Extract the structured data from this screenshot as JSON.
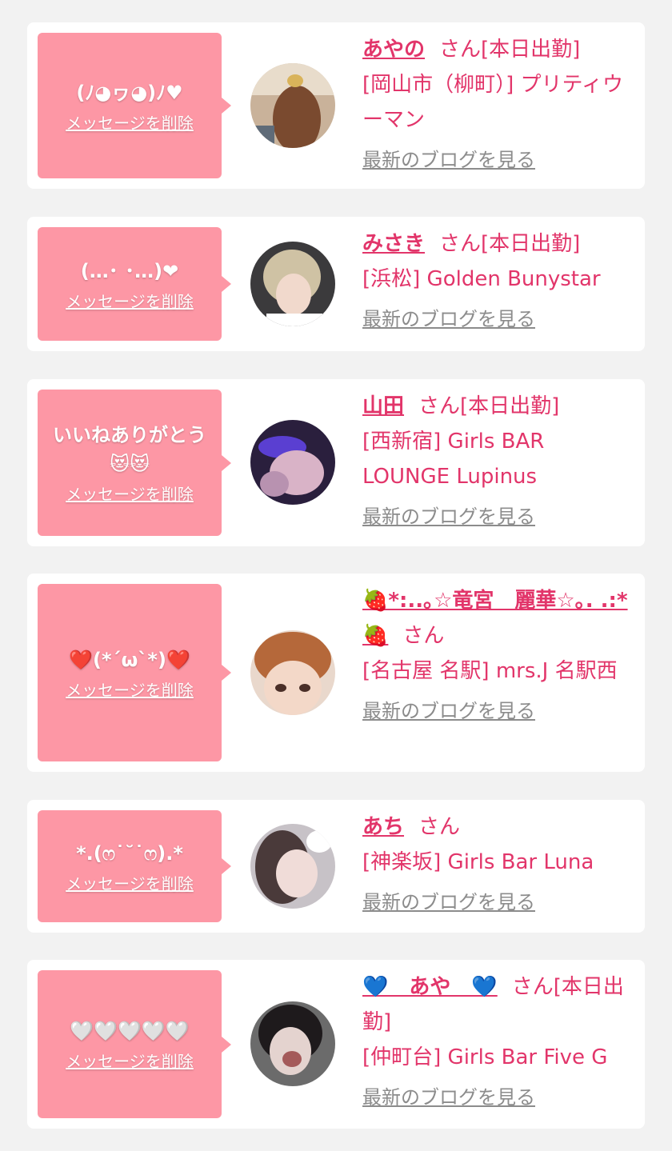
{
  "colors": {
    "background": "#f2f2f2",
    "card": "#ffffff",
    "bubble": "#fd97a5",
    "accent": "#e2356a",
    "link_gray": "#8c8c8c"
  },
  "cards": [
    {
      "message": "(ﾉ◕ヮ◕)ﾉ♥",
      "delete_label": "メッセージを削除",
      "name": "あやの",
      "status": "さん[本日出勤]",
      "shop": "[岡山市（柳町）] プリティウーマン",
      "blog_label": "最新のブログを見る",
      "avatar_icon": "avatar-photo"
    },
    {
      "message": "(…･ ･…)❤",
      "delete_label": "メッセージを削除",
      "name": "みさき",
      "status": "さん[本日出勤]",
      "shop": "[浜松] Golden Bunystar",
      "blog_label": "最新のブログを見る",
      "avatar_icon": "avatar-photo"
    },
    {
      "message": "いいねありがとう😻😻",
      "delete_label": "メッセージを削除",
      "name": "山田",
      "status": "さん[本日出勤]",
      "shop": "[西新宿] Girls BAR LOUNGE Lupinus",
      "blog_label": "最新のブログを見る",
      "avatar_icon": "avatar-photo"
    },
    {
      "message": "❤️(*´ω`*)❤️",
      "delete_label": "メッセージを削除",
      "name": "🍓*:..｡☆竜宮　麗華☆｡. .:*🍓",
      "status": "さん",
      "shop": "[名古屋 名駅] mrs.J 名駅西",
      "blog_label": "最新のブログを見る",
      "avatar_icon": "avatar-photo"
    },
    {
      "message": "*.(ෆ˙˘˙ෆ).*",
      "delete_label": "メッセージを削除",
      "name": "あち",
      "status": "さん",
      "shop": "[神楽坂] Girls Bar Luna",
      "blog_label": "最新のブログを見る",
      "avatar_icon": "avatar-photo"
    },
    {
      "message": "🤍🤍🤍🤍🤍",
      "delete_label": "メッセージを削除",
      "name": "💙　あや　💙",
      "status": "さん[本日出勤]",
      "shop": "[仲町台] Girls Bar Five G",
      "blog_label": "最新のブログを見る",
      "avatar_icon": "avatar-photo"
    }
  ]
}
